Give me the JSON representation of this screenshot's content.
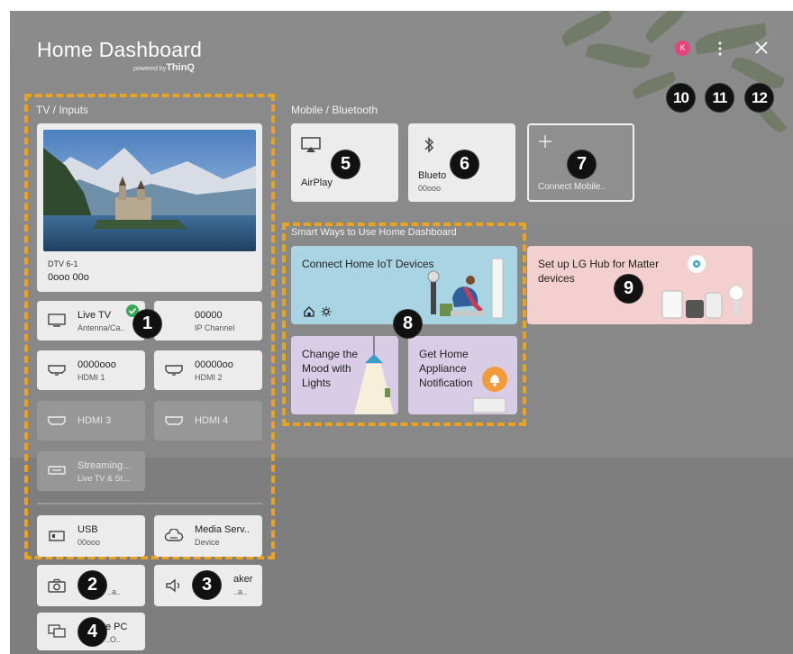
{
  "header": {
    "title": "Home Dashboard",
    "powered_prefix": "powered by",
    "powered_brand": "ThinQ",
    "avatar_letter": "K"
  },
  "sections": {
    "tv_inputs": "TV / Inputs",
    "mobile": "Mobile / Bluetooth",
    "smart_ways": "Smart Ways to Use Home Dashboard"
  },
  "tv": {
    "channel": "DTV 6-1",
    "program": "0ooo 00o"
  },
  "inputs": [
    {
      "label": "Live TV",
      "sub": "Antenna/Ca..",
      "icon": "tv-icon"
    },
    {
      "label": "00000",
      "sub": "IP Channel",
      "icon": "ip-channel-icon"
    },
    {
      "label": "0000ooo",
      "sub": "HDMI 1",
      "icon": "hdmi-icon"
    },
    {
      "label": "00000oo",
      "sub": "HDMI 2",
      "icon": "hdmi-icon"
    },
    {
      "label": "HDMI 3",
      "sub": "",
      "icon": "hdmi-icon"
    },
    {
      "label": "HDMI 4",
      "sub": "",
      "icon": "hdmi-icon"
    },
    {
      "label": "Streaming...",
      "sub": "Live TV & St...",
      "icon": "streaming-icon"
    }
  ],
  "devices": [
    {
      "label": "USB",
      "sub": "00ooo",
      "icon": "usb-icon"
    },
    {
      "label": "Media Serv..",
      "sub": "Device",
      "icon": "cloud-icon"
    },
    {
      "label": "",
      "sub": "..a..",
      "icon": "camera-icon"
    },
    {
      "label": "aker",
      "sub": "..a..",
      "icon": "speaker-icon"
    },
    {
      "label": "e PC",
      "sub": "..O..",
      "icon": "pc-icon"
    }
  ],
  "mobile": [
    {
      "label": "AirPlay",
      "sub": "",
      "icon": "airplay-icon"
    },
    {
      "label": "Blueto",
      "sub": "00ooo",
      "icon": "bluetooth-icon"
    },
    {
      "label": "Connect  Mobile..",
      "sub": "",
      "icon": "plus-icon"
    }
  ],
  "smart": [
    {
      "title": "Connect Home IoT Devices"
    },
    {
      "title": "Set up LG Hub for Matter devices"
    },
    {
      "title": "Change the Mood with Lights"
    },
    {
      "title": "Get Home Appliance Notification"
    }
  ],
  "callouts": [
    "1",
    "2",
    "3",
    "4",
    "5",
    "6",
    "7",
    "8",
    "9",
    "10",
    "11",
    "12"
  ],
  "colors": {
    "accent_dashed": "#e9a31f",
    "avatar": "#e0457b",
    "iot_card": "#a9d4e4",
    "matter_card": "#f3cfcf",
    "purple_card": "#d9cce6"
  }
}
